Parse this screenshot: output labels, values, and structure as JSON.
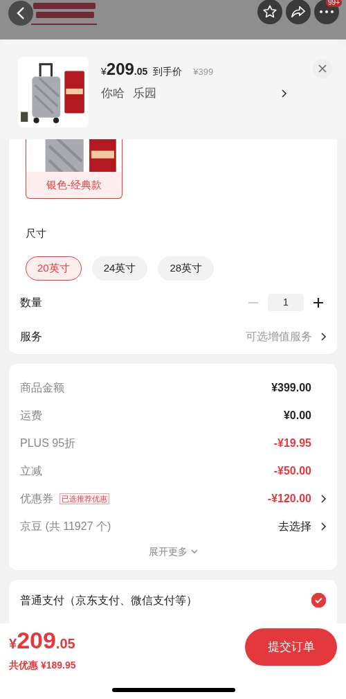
{
  "top_bar": {
    "badge": "99+"
  },
  "header": {
    "currency": "¥",
    "price_int": "209",
    "price_dec": ".05",
    "price_label": "到手价",
    "original_price": "¥399",
    "name": "你哈",
    "place": "乐园"
  },
  "colors": [
    {
      "label": "银色-经典款",
      "selected": true
    }
  ],
  "size": {
    "title": "尺寸",
    "options": [
      {
        "label": "20英寸",
        "selected": true
      },
      {
        "label": "24英寸",
        "selected": false
      },
      {
        "label": "28英寸",
        "selected": false
      }
    ]
  },
  "quantity": {
    "label": "数量",
    "value": "1",
    "minus_disabled": true
  },
  "service": {
    "label": "服务",
    "value": "可选增值服务"
  },
  "price_rows": [
    {
      "label": "商品金额",
      "value": "¥399.00",
      "kind": "plain",
      "arrow": false
    },
    {
      "label": "运费",
      "value": "¥0.00",
      "kind": "plain",
      "arrow": false
    },
    {
      "label": "PLUS 95折",
      "value": "-¥19.95",
      "kind": "discount",
      "arrow": false
    },
    {
      "label": "立减",
      "value": "-¥50.00",
      "kind": "discount",
      "arrow": false
    },
    {
      "label": "优惠券",
      "tag": "已选推荐优惠",
      "value": "-¥120.00",
      "kind": "discount",
      "arrow": true
    },
    {
      "label": "京豆 (共 11927 个)",
      "value": "去选择",
      "kind": "action",
      "arrow": true
    }
  ],
  "expand": "展开更多",
  "payment": {
    "label": "普通支付（京东支付、微信支付等）",
    "selected": true
  },
  "footer": {
    "currency": "¥",
    "price_int": "209",
    "price_dec": ".05",
    "saving": "共优惠 ¥189.95",
    "submit": "提交订单"
  }
}
